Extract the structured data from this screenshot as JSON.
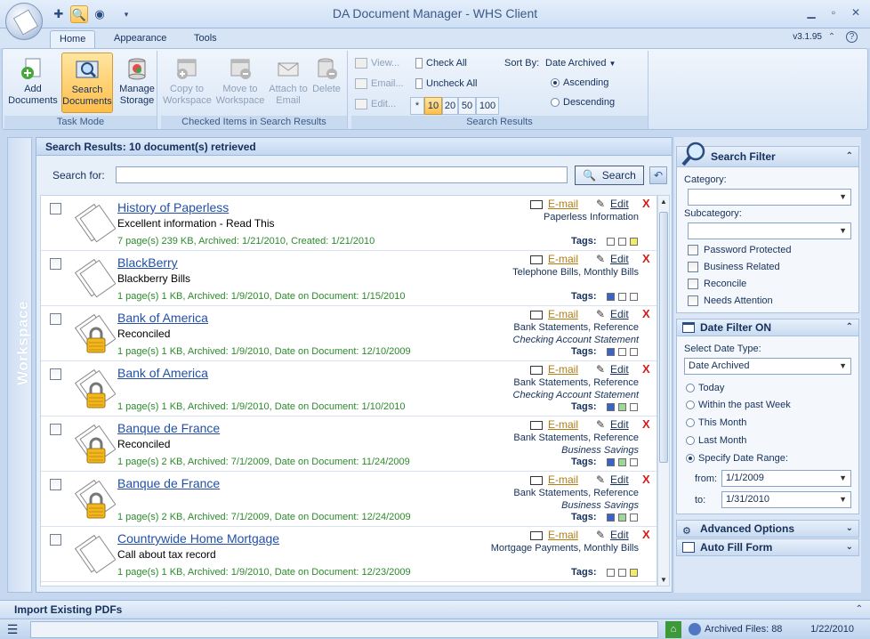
{
  "app": {
    "title": "DA Document Manager - WHS Client",
    "version": "v3.1.95"
  },
  "ribbon": {
    "tabs": [
      "Home",
      "Appearance",
      "Tools"
    ],
    "task_mode": {
      "label": "Task Mode",
      "buttons": [
        {
          "label": "Add Documents",
          "icon": "add-document-icon"
        },
        {
          "label": "Search Documents",
          "icon": "search-documents-icon"
        },
        {
          "label": "Manage Storage",
          "icon": "database-icon"
        }
      ]
    },
    "checked_items": {
      "label": "Checked Items in Search Results",
      "buttons": [
        {
          "label": "Copy to Workspace",
          "icon": "copy-workspace-icon"
        },
        {
          "label": "Move to Workspace",
          "icon": "move-workspace-icon"
        },
        {
          "label": "Attach to Email",
          "icon": "attach-email-icon"
        },
        {
          "label": "Delete",
          "icon": "delete-icon"
        }
      ]
    },
    "search_results": {
      "label": "Search Results",
      "view": "View...",
      "email": "Email...",
      "edit": "Edit...",
      "check_all": "Check All",
      "uncheck_all": "Uncheck All",
      "page_sizes": [
        "*",
        "10",
        "20",
        "50",
        "100"
      ],
      "selected_page_size": "10",
      "sort_by_label": "Sort By:",
      "sort_by_value": "Date Archived",
      "ascending": "Ascending",
      "descending": "Descending"
    }
  },
  "workspace": {
    "label": "Workspace"
  },
  "results": {
    "header": "Search Results:  10 document(s) retrieved",
    "search_label": "Search for:",
    "search_value": "",
    "search_button": "Search",
    "email_label": "E-mail",
    "edit_label": "Edit",
    "delete_label": "X",
    "tags_label": "Tags:",
    "rows": [
      {
        "title": "History of Paperless",
        "note": "Excellent information - Read This",
        "meta": "7 page(s) 239 KB, Archived: 1/21/2010, Created: 1/21/2010",
        "categories": "Paperless Information",
        "subcategory": "",
        "locked": false,
        "tags": [
          "#ffffff",
          "#ffffff",
          "#f2ec6a"
        ]
      },
      {
        "title": "BlackBerry",
        "note": "Blackberry Bills",
        "meta": "1 page(s) 1 KB, Archived: 1/9/2010, Date on Document: 1/15/2010",
        "categories": "Telephone Bills, Monthly Bills",
        "subcategory": "",
        "locked": false,
        "tags": [
          "#3a63c8",
          "#ffffff",
          "#ffffff"
        ]
      },
      {
        "title": "Bank of America",
        "note": "Reconciled",
        "meta": "1 page(s) 1 KB, Archived: 1/9/2010, Date on Document: 12/10/2009",
        "categories": "Bank Statements, Reference",
        "subcategory": "Checking Account Statement",
        "locked": true,
        "tags": [
          "#3a63c8",
          "#ffffff",
          "#ffffff"
        ]
      },
      {
        "title": "Bank of America",
        "note": "",
        "meta": "1 page(s) 1 KB, Archived: 1/9/2010, Date on Document: 1/10/2010",
        "categories": "Bank Statements, Reference",
        "subcategory": "Checking Account Statement",
        "locked": true,
        "tags": [
          "#3a63c8",
          "#9fd69a",
          "#ffffff"
        ]
      },
      {
        "title": "Banque de France",
        "note": "Reconciled",
        "meta": "1 page(s) 2 KB, Archived: 7/1/2009, Date on Document: 11/24/2009",
        "categories": "Bank Statements, Reference",
        "subcategory": "Business Savings",
        "locked": true,
        "tags": [
          "#3a63c8",
          "#9fd69a",
          "#ffffff"
        ]
      },
      {
        "title": "Banque de France",
        "note": "",
        "meta": "1 page(s) 2 KB, Archived: 7/1/2009, Date on Document: 12/24/2009",
        "categories": "Bank Statements, Reference",
        "subcategory": "Business Savings",
        "locked": true,
        "tags": [
          "#3a63c8",
          "#9fd69a",
          "#ffffff"
        ]
      },
      {
        "title": "Countrywide Home Mortgage",
        "note": "Call about tax record",
        "meta": "1 page(s) 1 KB, Archived: 1/9/2010, Date on Document: 12/23/2009",
        "categories": "Mortgage Payments, Monthly Bills",
        "subcategory": "",
        "locked": false,
        "tags": [
          "#ffffff",
          "#ffffff",
          "#f2ec6a"
        ]
      }
    ]
  },
  "search_filter": {
    "title": "Search Filter",
    "category_label": "Category:",
    "category_value": "",
    "subcategory_label": "Subcategory:",
    "subcategory_value": "",
    "checks": [
      "Password Protected",
      "Business Related",
      "Reconcile",
      "Needs Attention"
    ]
  },
  "date_filter": {
    "title": "Date Filter ON",
    "type_label": "Select Date Type:",
    "type_value": "Date Archived",
    "options": [
      "Today",
      "Within the past Week",
      "This Month",
      "Last Month",
      "Specify Date Range:"
    ],
    "selected": "Specify Date Range:",
    "from_label": "from:",
    "from_value": "1/1/2009",
    "to_label": "to:",
    "to_value": "1/31/2010"
  },
  "advanced_options": {
    "title": "Advanced Options"
  },
  "auto_fill": {
    "title": "Auto Fill Form"
  },
  "import_bar": {
    "label": "Import Existing PDFs"
  },
  "status": {
    "archived_files": "Archived Files: 88",
    "date": "1/22/2010"
  }
}
